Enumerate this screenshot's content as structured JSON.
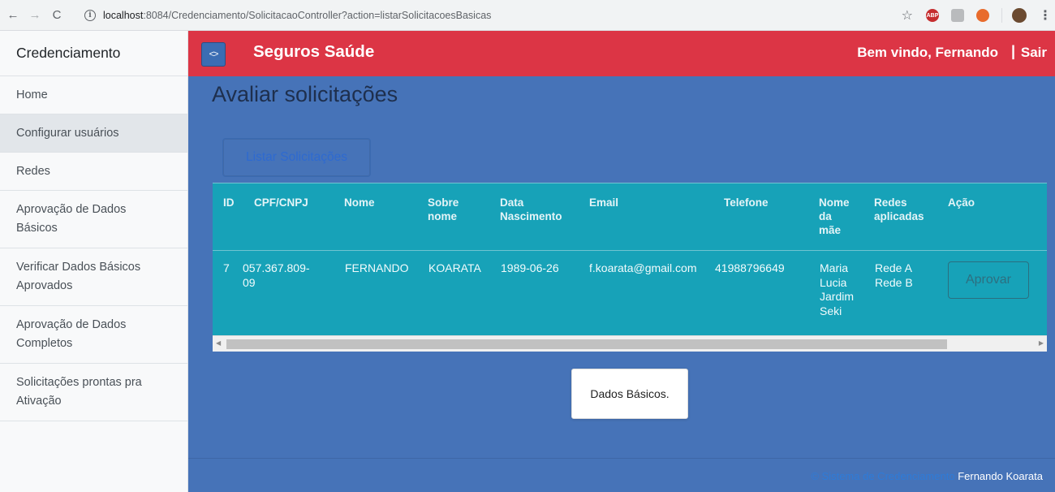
{
  "browser": {
    "url_host": "localhost",
    "url_path": ":8084/Credenciamento/SolicitacaoController?action=listarSolicitacoesBasicas",
    "info_label": "i",
    "back_label": "←",
    "forward_label": "→",
    "reload_label": "C",
    "star_label": "☆",
    "abp_label": "ABP",
    "menu_label": "⋮"
  },
  "sidebar": {
    "heading": "Credenciamento",
    "items": [
      {
        "label": "Home"
      },
      {
        "label": "Configurar usuários",
        "active": true
      },
      {
        "label": "Redes"
      },
      {
        "label": "Aprovação de Dados Básicos"
      },
      {
        "label": "Verificar Dados Básicos Aprovados"
      },
      {
        "label": "Aprovação de Dados Completos"
      },
      {
        "label": "Solicitações prontas pra Ativação"
      }
    ]
  },
  "navbar": {
    "toggle_label": "<>",
    "brand": "Seguros Saúde",
    "welcome": "Bem vindo, Fernando",
    "separator": "|",
    "logout": "Sair"
  },
  "page": {
    "title": "Avaliar solicitações",
    "list_button": "Listar Solicitações"
  },
  "table": {
    "headers": {
      "id": "ID",
      "cpf": "CPF/CNPJ",
      "nome": "Nome",
      "sobrenome_1": "Sobre",
      "sobrenome_2": "nome",
      "data_1": "Data",
      "data_2": "Nascimento",
      "email": "Email",
      "telefone": "Telefone",
      "mae_1": "Nome",
      "mae_2": "da",
      "mae_3": "mãe",
      "redes_1": "Redes",
      "redes_2": "aplicadas",
      "acao": "Ação"
    },
    "row": {
      "id": "7",
      "cpf_1": "057.367.809-",
      "cpf_2": "09",
      "nome": "FERNANDO",
      "sobrenome": "KOARATA",
      "data": "1989-06-26",
      "email": "f.koarata@gmail.com",
      "telefone": "41988796649",
      "mae_1": "Maria",
      "mae_2": "Lucia",
      "mae_3": "Jardim",
      "mae_4": "Seki",
      "rede_1": "Rede A",
      "rede_2": "Rede B",
      "action_label": "Aprovar"
    },
    "scroll_left": "◀",
    "scroll_right": "▶"
  },
  "toast": {
    "message": "Dados Básicos."
  },
  "footer": {
    "copyright": "© Sistema de Credenciamento",
    "author": "Fernando Koarata"
  },
  "colors": {
    "navbar": "#dc3545",
    "main_bg": "#4673b8",
    "table_bg": "#17a2b8",
    "sidebar_bg": "#f8f9fa"
  }
}
